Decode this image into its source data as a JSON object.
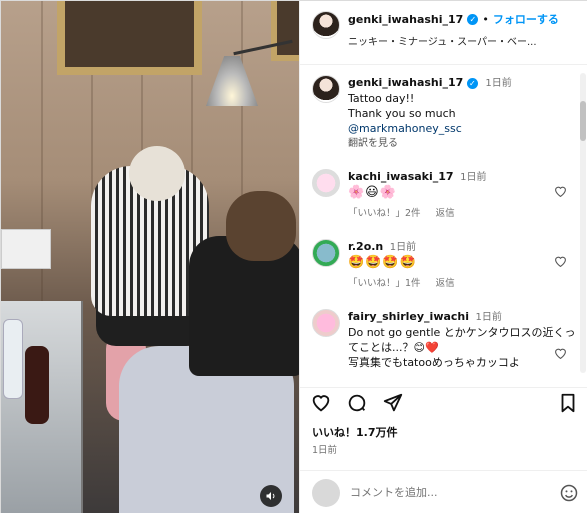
{
  "header": {
    "username": "genki_iwahashi_17",
    "follow_label": "フォローする",
    "sub": "ニッキー・ミナージュ・スーパー・ベー..."
  },
  "caption": {
    "username": "genki_iwahashi_17",
    "time": "1日前",
    "line1": "Tattoo day!!",
    "line2": "Thank you so much",
    "mention": "@markmahoney_ssc",
    "translate": "翻訳を見る"
  },
  "comments": [
    {
      "username": "kachi_iwasaki_17",
      "time": "1日前",
      "text": "🌸😃🌸",
      "likes": "「いいね！」2件",
      "reply": "返信"
    },
    {
      "username": "r.2o.n",
      "time": "1日前",
      "text": "🤩🤩🤩🤩",
      "likes": "「いいね！」1件",
      "reply": "返信"
    },
    {
      "username": "fairy_shirley_iwachi",
      "time": "1日前",
      "text": "Do not go gentle とかケンタウロスの近くってことは...？😊❤️",
      "text2": "写真集でもtatooめっちゃカッコよ"
    }
  ],
  "likes": "いいね！1.7万件",
  "date": "1日前",
  "comment_box": {
    "placeholder": "コメントを追加..."
  },
  "icons": {
    "heart": "heart-icon",
    "comment": "comment-icon",
    "share": "share-icon",
    "bookmark": "bookmark-icon",
    "emoji": "emoji-icon",
    "sound": "sound-icon"
  },
  "colors": {
    "accent": "#0095f6",
    "muted": "#737373"
  }
}
